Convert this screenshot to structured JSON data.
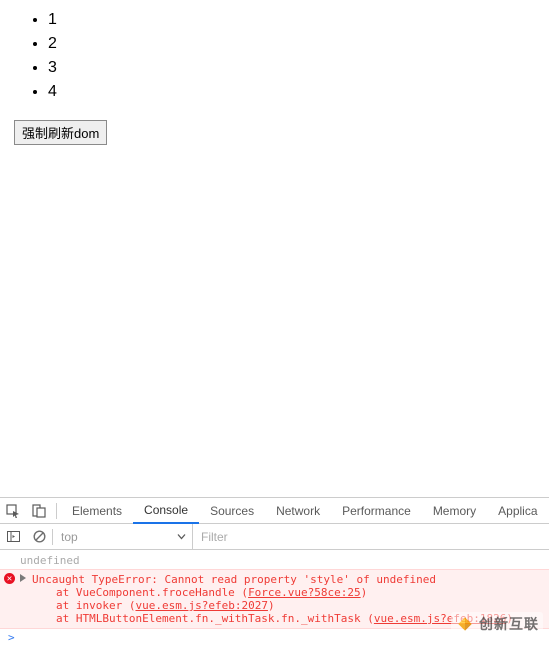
{
  "page": {
    "items": [
      "1",
      "2",
      "3",
      "4"
    ],
    "button_label": "强制刷新dom"
  },
  "devtools": {
    "tabs": [
      "Elements",
      "Console",
      "Sources",
      "Network",
      "Performance",
      "Memory",
      "Applica"
    ],
    "active_tab": "Console",
    "context": "top",
    "filter_placeholder": "Filter",
    "console": {
      "log_value": "undefined",
      "error_message": "Uncaught TypeError: Cannot read property 'style' of undefined",
      "stack": [
        {
          "prefix": "at VueComponent.froceHandle (",
          "link": "Force.vue?58ce:25",
          "suffix": ")"
        },
        {
          "prefix": "at invoker (",
          "link": "vue.esm.js?efeb:2027",
          "suffix": ")"
        },
        {
          "prefix": "at HTMLButtonElement.fn._withTask.fn._withTask (",
          "link": "vue.esm.js?efeb:1826",
          "suffix": ")"
        }
      ]
    }
  },
  "watermark": "创新互联"
}
